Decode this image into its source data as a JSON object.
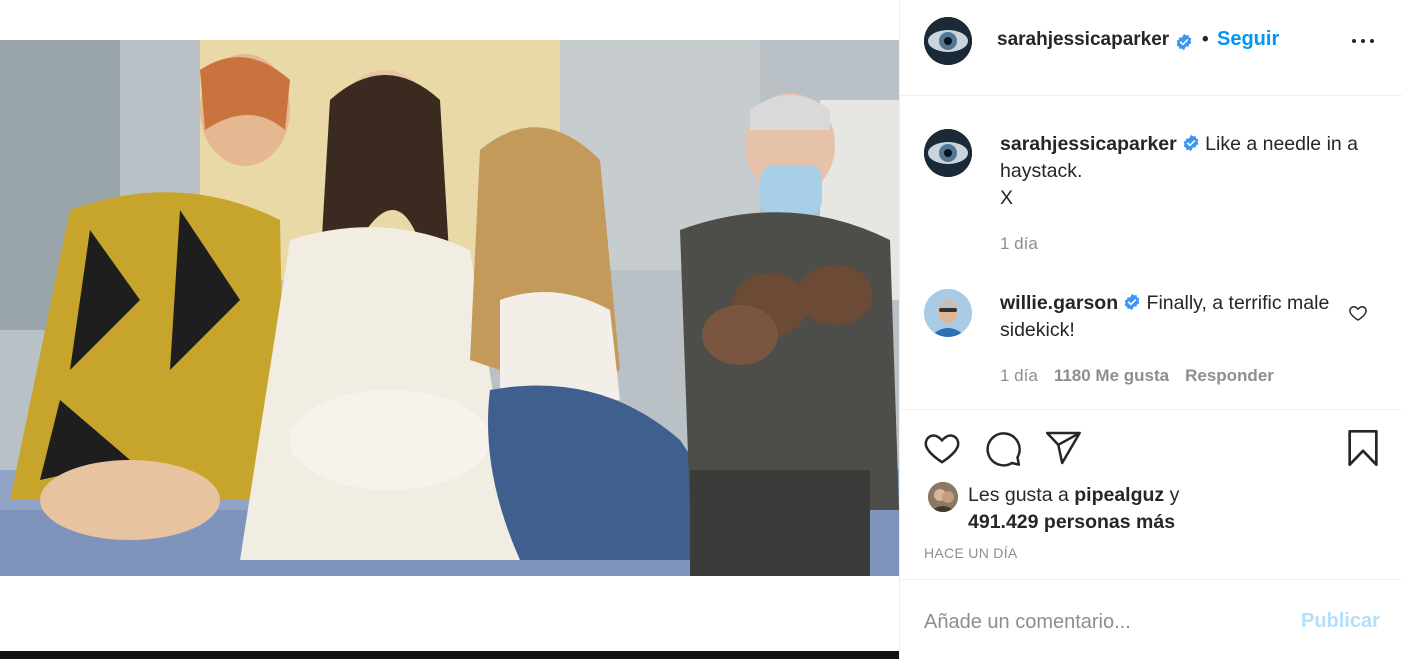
{
  "post": {
    "media_alt_icon": "photo"
  },
  "header": {
    "username": "sarahjessicaparker",
    "dot": "•",
    "follow_label": "Seguir",
    "more_icon": "more-horizontal-icon"
  },
  "caption": {
    "username": "sarahjessicaparker",
    "text_line1": "Like a needle in a haystack.",
    "text_line2": "X",
    "time": "1 día"
  },
  "comments": [
    {
      "username": "willie.garson",
      "text": "Finally, a terrific male sidekick!",
      "time": "1 día",
      "likes": "1180 Me gusta",
      "reply_label": "Responder"
    }
  ],
  "actions": {
    "like_icon": "heart-icon",
    "comment_icon": "comment-icon",
    "share_icon": "share-icon",
    "save_icon": "bookmark-icon"
  },
  "likes_summary": {
    "prefix": "Les gusta a ",
    "user": "pipealguz",
    "joiner": " y",
    "others": "491.429 personas más"
  },
  "timestamp": "HACE UN DÍA",
  "add_comment": {
    "placeholder": "Añade un comentario...",
    "publish_label": "Publicar"
  },
  "colors": {
    "accent": "#0095f6",
    "accent_disabled": "#b2dffc",
    "verified": "#3897f0",
    "muted_text": "#8e8e8e",
    "text": "#262626"
  }
}
